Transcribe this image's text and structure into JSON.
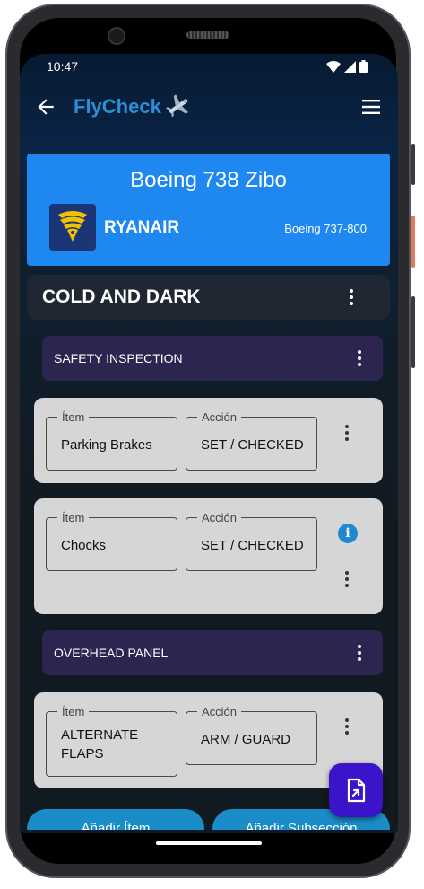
{
  "status_bar": {
    "time": "10:47"
  },
  "app_bar": {
    "title": "FlyCheck"
  },
  "aircraft": {
    "name": "Boeing 738 Zibo",
    "airline": "RYANAIR",
    "model": "Boeing 737-800"
  },
  "section": {
    "title": "COLD AND DARK"
  },
  "subsections": [
    {
      "title": "SAFETY INSPECTION"
    },
    {
      "title": "OVERHEAD PANEL"
    }
  ],
  "items": [
    {
      "item_label": "Ítem",
      "item_value": "Parking Brakes",
      "action_label": "Acción",
      "action_value": "SET / CHECKED"
    },
    {
      "item_label": "Ítem",
      "item_value": "Chocks",
      "action_label": "Acción",
      "action_value": "SET / CHECKED"
    },
    {
      "item_label": "Ítem",
      "item_value": "ALTERNATE FLAPS",
      "action_label": "Acción",
      "action_value": "ARM / GUARD"
    }
  ],
  "buttons": {
    "add_item": "Añadir Ítem",
    "add_subsection": "Añadir Subsección"
  },
  "colors": {
    "aircraft_card": "#1e88f0",
    "subsection": "#2b2550",
    "item_card": "#d6d6d6",
    "fab": "#3a14c8",
    "button": "#1a8cc8",
    "title_accent": "#2a8fd6"
  },
  "icons": [
    "back-arrow-icon",
    "airplane-icon",
    "hamburger-menu-icon",
    "kebab-menu-icon",
    "info-icon",
    "document-export-icon",
    "wifi-icon",
    "signal-icon",
    "battery-icon"
  ]
}
